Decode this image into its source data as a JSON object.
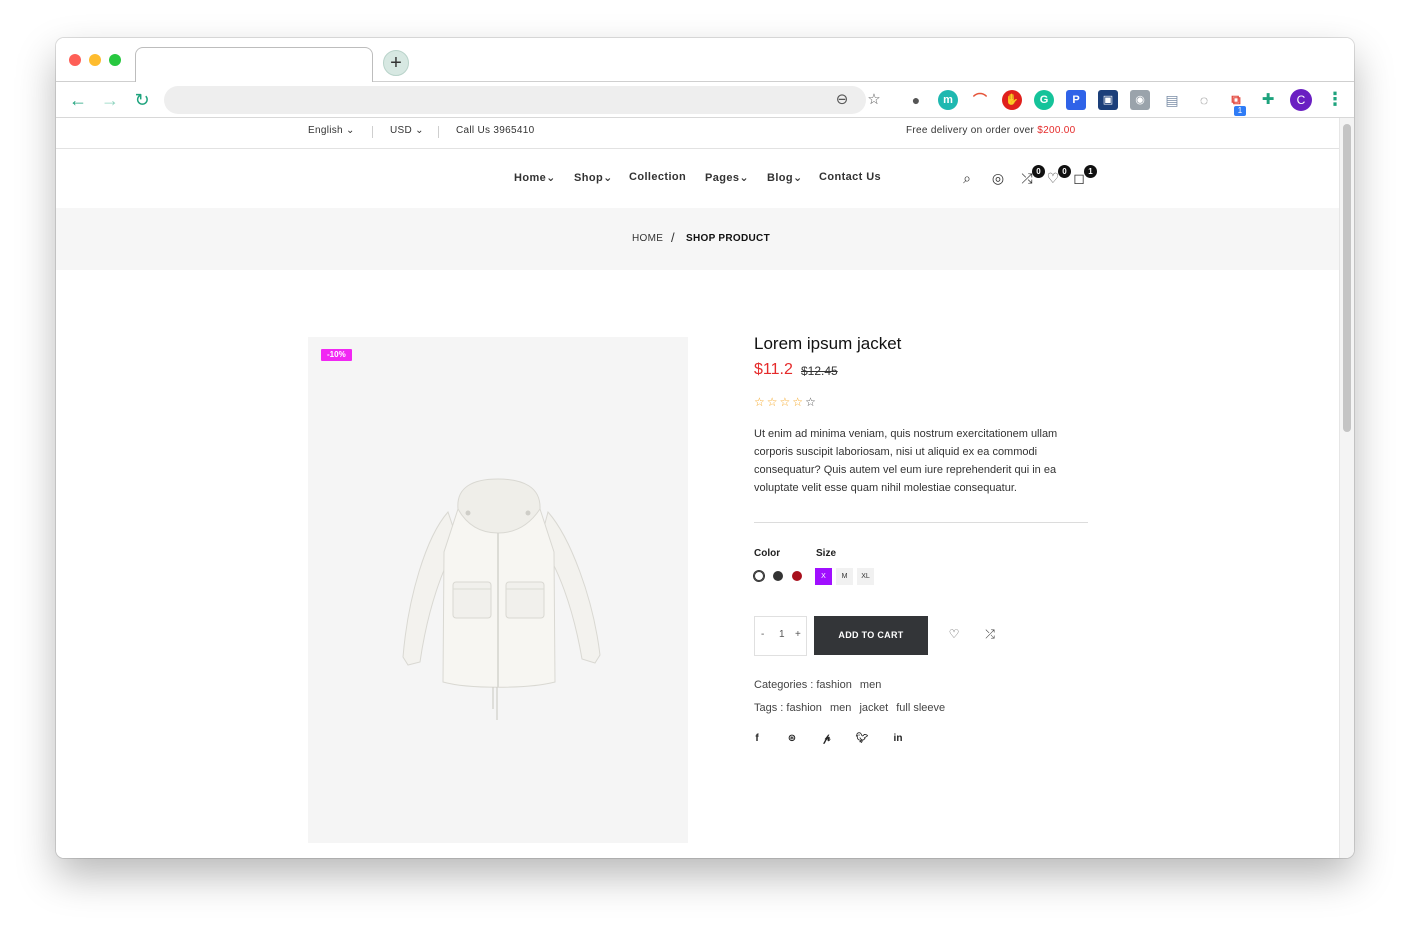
{
  "browser": {
    "tab_title": "",
    "new_tab_symbol": "+",
    "url": "",
    "extensions": [
      "bulb",
      "m",
      "rainbow",
      "stop",
      "grammarly",
      "pocket",
      "book",
      "person",
      "reader",
      "chat",
      "flow"
    ],
    "extension_badge": "1",
    "profile_initial": "C"
  },
  "topbar": {
    "language": "English",
    "currency": "USD",
    "phone": "Call Us 3965410",
    "delivery_text": "Free delivery on order over",
    "delivery_amount": "$200.00"
  },
  "nav": {
    "items": [
      "Home",
      "Shop",
      "Collection",
      "Pages",
      "Blog",
      "Contact Us"
    ],
    "compare_count": "0",
    "wishlist_count": "0",
    "cart_count": "1"
  },
  "breadcrumb": {
    "home": "HOME",
    "separator": "/",
    "current": "SHOP PRODUCT"
  },
  "product": {
    "badge": "-10%",
    "title": "Lorem ipsum jacket",
    "price": "$11.2",
    "old_price": "$12.45",
    "rating": 4,
    "rating_max": 5,
    "description": "Ut enim ad minima veniam, quis nostrum exercitationem ullam corporis suscipit laboriosam, nisi ut aliquid ex ea commodi consequatur? Quis autem vel eum iure reprehenderit qui in ea voluptate velit esse quam nihil molestiae consequatur.",
    "color_label": "Color",
    "colors": [
      "#ffffff",
      "#333333",
      "#a80f1c"
    ],
    "size_label": "Size",
    "sizes": [
      "X",
      "M",
      "XL"
    ],
    "selected_size": "X",
    "qty_minus": "-",
    "quantity": "1",
    "qty_plus": "+",
    "add_to_cart": "ADD TO CART",
    "categories_label": "Categories :",
    "categories": [
      "fashion",
      "men"
    ],
    "tags_label": "Tags :",
    "tags": [
      "fashion",
      "men",
      "jacket",
      "full sleeve"
    ]
  },
  "colors": {
    "accent_sale": "#f127f3",
    "price_red": "#e52b2b",
    "size_active": "#a00fff",
    "button_dark": "#333538"
  }
}
